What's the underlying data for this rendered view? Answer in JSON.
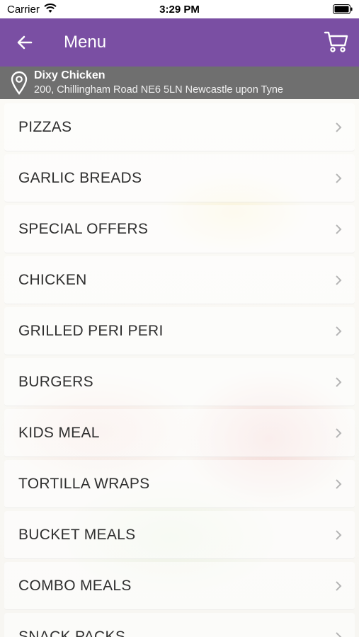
{
  "status_bar": {
    "carrier": "Carrier",
    "time": "3:29 PM"
  },
  "header": {
    "title": "Menu",
    "back_icon": "back-arrow-icon",
    "cart_icon": "cart-icon",
    "color": "#7a4fa3"
  },
  "location": {
    "name": "Dixy Chicken",
    "address": "200, Chillingham Road NE6 5LN Newcastle upon Tyne",
    "icon": "location-pin-icon"
  },
  "menu": {
    "items": [
      {
        "label": "PIZZAS"
      },
      {
        "label": "GARLIC BREADS"
      },
      {
        "label": "SPECIAL OFFERS"
      },
      {
        "label": "CHICKEN"
      },
      {
        "label": "GRILLED PERI PERI"
      },
      {
        "label": "BURGERS"
      },
      {
        "label": "KIDS MEAL"
      },
      {
        "label": "TORTILLA WRAPS"
      },
      {
        "label": "BUCKET MEALS"
      },
      {
        "label": "COMBO MEALS"
      },
      {
        "label": "SNACK PACKS"
      }
    ]
  }
}
